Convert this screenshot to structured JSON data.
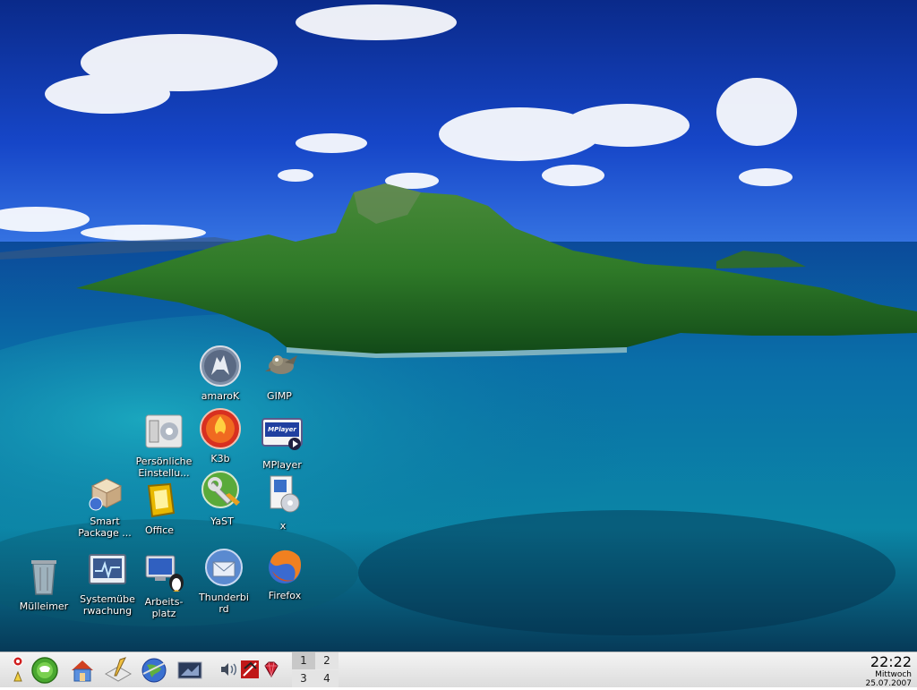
{
  "desktop": {
    "icons": [
      {
        "id": "amarok",
        "label": "amaroK"
      },
      {
        "id": "gimp",
        "label": "GIMP"
      },
      {
        "id": "persoenliche",
        "label": "Persönliche Einstellu..."
      },
      {
        "id": "k3b",
        "label": "K3b"
      },
      {
        "id": "mplayer",
        "label": "MPlayer",
        "badge": "MPlayer"
      },
      {
        "id": "smart",
        "label": "Smart Package ..."
      },
      {
        "id": "office",
        "label": "Office"
      },
      {
        "id": "yast",
        "label": "YaST"
      },
      {
        "id": "x",
        "label": "x"
      },
      {
        "id": "muelleimer",
        "label": "Mülleimer"
      },
      {
        "id": "systemueberwachung",
        "label": "Systemübe rwachung"
      },
      {
        "id": "arbeitsplatz",
        "label": "Arbeits- platz"
      },
      {
        "id": "thunderbird",
        "label": "Thunderbi rd"
      },
      {
        "id": "firefox",
        "label": "Firefox"
      }
    ]
  },
  "panel": {
    "buttons": [
      {
        "icon": "kde-menu-icon"
      },
      {
        "icon": "home-folder-icon"
      },
      {
        "icon": "edit-icon"
      },
      {
        "icon": "browser-icon"
      },
      {
        "icon": "show-desktop-icon"
      }
    ],
    "tray": [
      "volume-icon",
      "network-icon",
      "ruby-icon"
    ],
    "pager": [
      "1",
      "2",
      "3",
      "4"
    ],
    "clock": {
      "time": "22:22",
      "day": "Mittwoch",
      "date": "25.07.2007"
    }
  }
}
